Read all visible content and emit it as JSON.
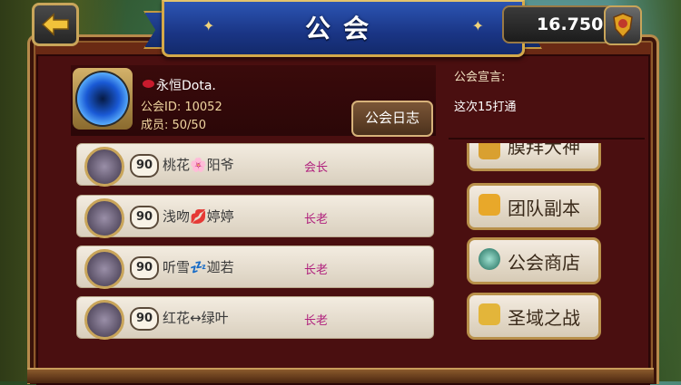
{
  "header": {
    "title": "公会"
  },
  "currency": {
    "value": "16.750",
    "icon": "shield-coin-icon"
  },
  "guild": {
    "name": "永恒Dota.",
    "id_label": "公会ID: 10052",
    "members_label": "成员: 50/50",
    "log_button": "公会日志"
  },
  "announcement": {
    "title": "公会宣言:",
    "text": "这次15打通"
  },
  "members": [
    {
      "level": "90",
      "name": "桃花🌸阳爷",
      "role": "会长"
    },
    {
      "level": "90",
      "name": "浅吻💋婷婷",
      "role": "长老"
    },
    {
      "level": "90",
      "name": "听雪💤迦若",
      "role": "长老"
    },
    {
      "level": "90",
      "name": "红花↔绿叶",
      "role": "长老"
    }
  ],
  "side_buttons": {
    "worship": "膜拜大神",
    "team_dungeon": "团队副本",
    "guild_shop": "公会商店",
    "holy_war": "圣域之战"
  },
  "colors": {
    "banner": "#1a3585",
    "frame": "#6b2a14",
    "role": "#b0207d",
    "gold": "#c9a55a"
  }
}
